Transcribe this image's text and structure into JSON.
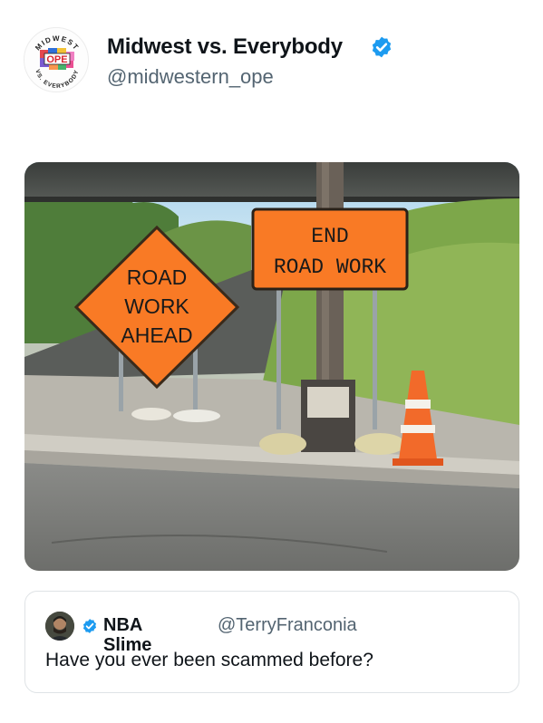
{
  "tweet": {
    "author": {
      "display_name": "Midwest vs. Everybody",
      "handle": "@midwestern_ope",
      "verified": true,
      "avatar_icon": "midwest-vs-everybody-logo",
      "avatar_logo_text": {
        "top": "MIDWEST",
        "middle": "OPE",
        "bottom": "VS. EVERYBODY"
      }
    },
    "media": {
      "signs": {
        "diamond": [
          "ROAD",
          "WORK",
          "AHEAD"
        ],
        "rect": [
          "END",
          "ROAD WORK"
        ]
      }
    }
  },
  "quote": {
    "author": {
      "display_name": "NBA Slime",
      "handle": "@TerryFranconia",
      "verified": true,
      "avatar_icon": "profile-photo"
    },
    "text": "Have you ever been scammed before?"
  },
  "colors": {
    "verified_blue": "#1d9bf0",
    "sign_orange": "#f97a25",
    "handle_gray": "#536471"
  }
}
